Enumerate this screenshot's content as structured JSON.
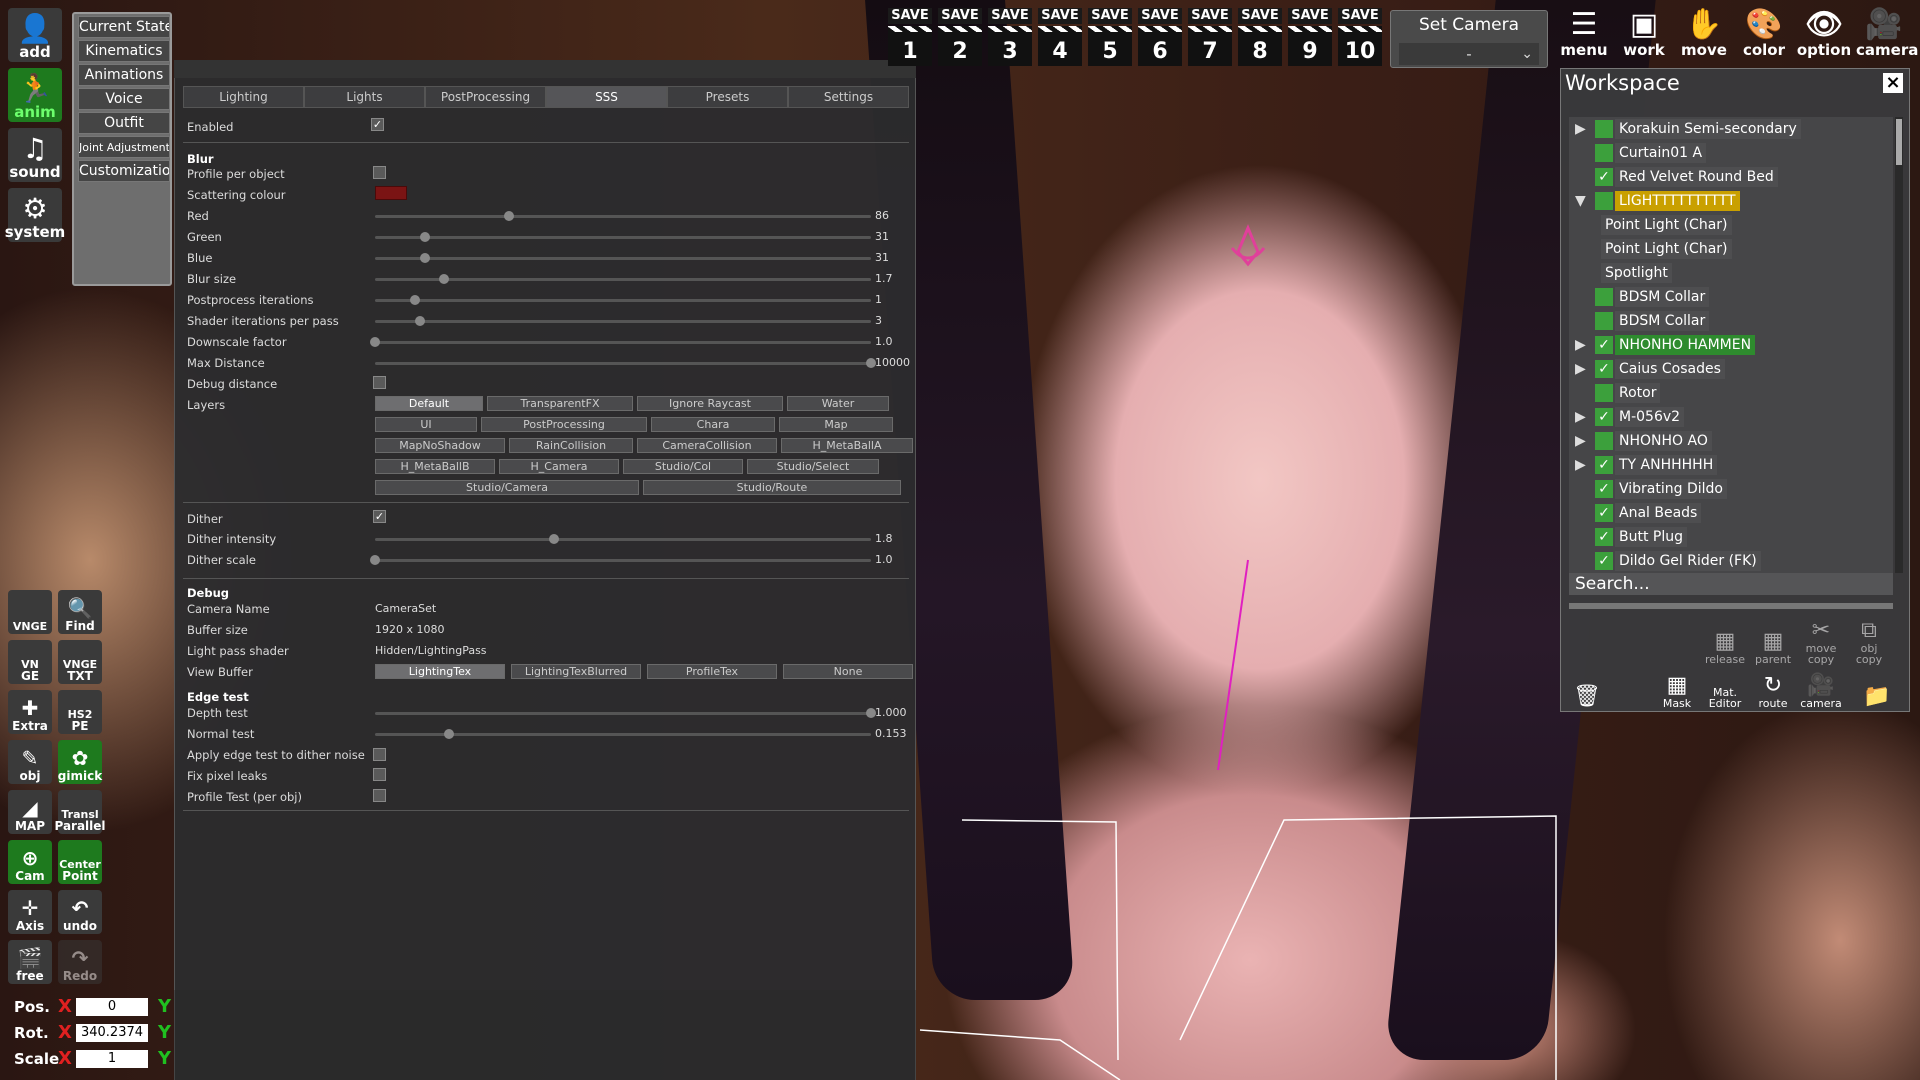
{
  "left_toolbar": {
    "add": "add",
    "anim": "anim",
    "sound": "sound",
    "system": "system"
  },
  "left_menu": [
    "Current State",
    "Kinematics",
    "Animations",
    "Voice",
    "Outfit",
    "Joint Adjustment",
    "Customization"
  ],
  "sss_panel": {
    "tabs": [
      "Lighting",
      "Lights",
      "PostProcessing",
      "SSS",
      "Presets",
      "Settings"
    ],
    "active_tab": "SSS",
    "enabled_label": "Enabled",
    "blur_header": "Blur",
    "profile_per_object": "Profile per object",
    "scattering_colour": "Scattering colour",
    "scattering_color_hex": "#7a1414",
    "sliders": [
      {
        "label": "Red",
        "value": "86",
        "fraction": 0.27
      },
      {
        "label": "Green",
        "value": "31",
        "fraction": 0.1
      },
      {
        "label": "Blue",
        "value": "31",
        "fraction": 0.1
      },
      {
        "label": "Blur size",
        "value": "1.7",
        "fraction": 0.14
      },
      {
        "label": "Postprocess iterations",
        "value": "1",
        "fraction": 0.08
      },
      {
        "label": "Shader iterations per pass",
        "value": "3",
        "fraction": 0.09
      },
      {
        "label": "Downscale factor",
        "value": "1.0",
        "fraction": 0.0
      },
      {
        "label": "Max Distance",
        "value": "10000",
        "fraction": 1.0
      }
    ],
    "debug_distance": "Debug distance",
    "layers_label": "Layers",
    "layers": [
      [
        "Default",
        "TransparentFX",
        "Ignore Raycast",
        "Water"
      ],
      [
        "UI",
        "PostProcessing",
        "Chara",
        "Map"
      ],
      [
        "MapNoShadow",
        "RainCollision",
        "CameraCollision",
        "H_MetaBallA"
      ],
      [
        "H_MetaBallB",
        "H_Camera",
        "Studio/Col",
        "Studio/Select"
      ],
      [
        "Studio/Camera",
        "Studio/Route"
      ]
    ],
    "dither_label": "Dither",
    "dither_intensity": {
      "label": "Dither intensity",
      "value": "1.8",
      "fraction": 0.36
    },
    "dither_scale": {
      "label": "Dither scale",
      "value": "1.0",
      "fraction": 0.0
    },
    "debug_header": "Debug",
    "camera_name_label": "Camera Name",
    "camera_name": "CameraSet",
    "buffer_size_label": "Buffer size",
    "buffer_size": "1920 x 1080",
    "light_pass_shader_label": "Light pass shader",
    "light_pass_shader": "Hidden/LightingPass",
    "view_buffer_label": "View Buffer",
    "view_buffers": [
      "LightingTex",
      "LightingTexBlurred",
      "ProfileTex",
      "None"
    ],
    "edge_test_header": "Edge test",
    "depth_test": {
      "label": "Depth test",
      "value": "1.000",
      "fraction": 1.0
    },
    "normal_test": {
      "label": "Normal test",
      "value": "0.153",
      "fraction": 0.15
    },
    "apply_edge_test": "Apply edge test to dither noise",
    "fix_pixel_leaks": "Fix pixel leaks",
    "profile_test": "Profile Test (per obj)"
  },
  "save_bar": {
    "save_label": "SAVE",
    "slots": [
      "1",
      "2",
      "3",
      "4",
      "5",
      "6",
      "7",
      "8",
      "9",
      "10"
    ]
  },
  "set_camera": {
    "title": "Set Camera",
    "value": "-"
  },
  "top_buttons": [
    "menu",
    "work",
    "move",
    "color",
    "option",
    "camera"
  ],
  "workspace": {
    "title": "Workspace",
    "items": [
      {
        "label": "Korakuin Semi-secondary",
        "expand": "▶",
        "checked": false,
        "style": ""
      },
      {
        "label": "Curtain01 A",
        "expand": "",
        "checked": false,
        "style": ""
      },
      {
        "label": "Red Velvet Round Bed",
        "expand": "",
        "checked": true,
        "style": ""
      },
      {
        "label": "LIGHTTTTTTTTTT",
        "expand": "▼",
        "checked": false,
        "style": "hl"
      },
      {
        "label": "Point Light (Char)",
        "expand": "",
        "checked": false,
        "style": "child"
      },
      {
        "label": "Point Light (Char)",
        "expand": "",
        "checked": false,
        "style": "child"
      },
      {
        "label": "Spotlight",
        "expand": "",
        "checked": false,
        "style": "child"
      },
      {
        "label": "BDSM Collar",
        "expand": "",
        "checked": false,
        "style": ""
      },
      {
        "label": "BDSM Collar",
        "expand": "",
        "checked": false,
        "style": ""
      },
      {
        "label": "NHONHO HAMMEN",
        "expand": "▶",
        "checked": true,
        "style": "gr"
      },
      {
        "label": "Caius Cosades",
        "expand": "▶",
        "checked": true,
        "style": ""
      },
      {
        "label": "Rotor",
        "expand": "",
        "checked": false,
        "style": ""
      },
      {
        "label": "M-056v2",
        "expand": "▶",
        "checked": true,
        "style": ""
      },
      {
        "label": "NHONHO AO",
        "expand": "▶",
        "checked": false,
        "style": ""
      },
      {
        "label": "TY ANHHHHH",
        "expand": "▶",
        "checked": true,
        "style": ""
      },
      {
        "label": "Vibrating Dildo",
        "expand": "",
        "checked": true,
        "style": ""
      },
      {
        "label": "Anal Beads",
        "expand": "",
        "checked": true,
        "style": ""
      },
      {
        "label": "Butt Plug",
        "expand": "",
        "checked": true,
        "style": ""
      },
      {
        "label": "Dildo Gel Rider (FK)",
        "expand": "",
        "checked": true,
        "style": ""
      }
    ],
    "search_placeholder": "Search...",
    "row1_buttons": [
      "release",
      "parent",
      "move copy",
      "obj copy"
    ],
    "row2_buttons": [
      "Mask",
      "Mat. Editor",
      "route",
      "camera"
    ]
  },
  "left_tools": [
    {
      "top": "VNGE",
      "bottom": ""
    },
    {
      "top": "",
      "bottom": "Find"
    },
    {
      "top": "VN",
      "bottom": "GE"
    },
    {
      "top": "VNGE",
      "bottom": "TXT"
    },
    {
      "top": "",
      "bottom": "Extra"
    },
    {
      "top": "HS2",
      "bottom": "PE"
    },
    {
      "top": "",
      "bottom": "obj"
    },
    {
      "top": "",
      "bottom": "gimick"
    },
    {
      "top": "",
      "bottom": "MAP"
    },
    {
      "top": "Transl",
      "bottom": "Parallel"
    },
    {
      "top": "",
      "bottom": "Cam"
    },
    {
      "top": "Center",
      "bottom": "Point"
    },
    {
      "top": "",
      "bottom": "Axis"
    },
    {
      "top": "",
      "bottom": "undo"
    },
    {
      "top": "",
      "bottom": "free"
    },
    {
      "top": "",
      "bottom": "Redo"
    }
  ],
  "transform": {
    "pos_label": "Pos.",
    "rot_label": "Rot.",
    "scale_label": "Scale",
    "x_label": "X",
    "y_label": "Y",
    "pos_x": "0",
    "rot_x": "340.2374",
    "scale_x": "1"
  }
}
